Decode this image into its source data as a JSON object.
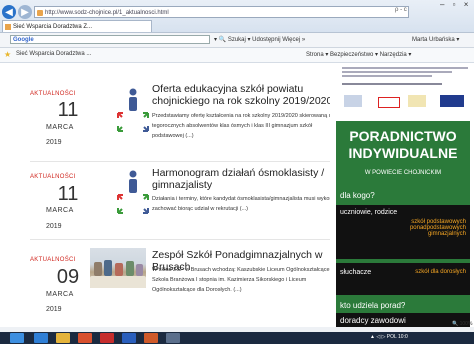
{
  "browser": {
    "url": "http://www.sodz-chojnice.pl/1_aktualnosci.html",
    "tab_label": "Sieć Wsparcia Doradztwa Z...",
    "search_glyph": "ρ - c",
    "window_controls": "– ▫ ×"
  },
  "google_bar": {
    "brand": "Google",
    "tools": "▾ 🔍 Szukaj ▾  Udostępnij  Więcej »",
    "user": "Marta Urbańska ▾"
  },
  "favorites": {
    "site": "Sieć Wsparcia Doradztwa ...",
    "commands": "Strona ▾  Bezpieczeństwo ▾  Narzędzia ▾"
  },
  "articles": [
    {
      "category": "AKTUALNOŚCI",
      "day": "11",
      "month": "MARCA",
      "year": "2019",
      "title": "Oferta edukacyjna szkół powiatu chojnickiego na rok szkolny 2019/2020",
      "excerpt": "Przedstawiamy ofertę kształcenia na rok szkolny 2019/2020 skierowaną do tegorocznych absolwentów klas ósmych i klas III gimnazjum szkół podstawowej (...)"
    },
    {
      "category": "AKTUALNOŚCI",
      "day": "11",
      "month": "MARCA",
      "year": "2019",
      "title": "Harmonogram działań ósmoklasisty / gimnazjalisty",
      "excerpt": "Działania i terminy, które kandydat ósmoklasista/gimnazjalista musi wykonać i zachować biorąc udział w rekrutacji (...)"
    },
    {
      "category": "AKTUALNOŚCI",
      "day": "09",
      "month": "MARCA",
      "year": "2019",
      "title": "Zespół Szkół Ponadgimnazjalnych w Brusach",
      "excerpt": "W skład ZSP w Brusach wchodzą: Kaszubskie Liceum Ogólnokształcące, Szkoła Branżowa I stopnia im. Kazimierza Sikorskiego i Liceum Ogólnokształcące dla Dorosłych. (...)"
    }
  ],
  "sidebar": {
    "headline": "PORADNICTWO INDYWIDUALNE",
    "subline": "W POWIECIE CHOJNICKIM",
    "question1": "dla kogo?",
    "who1": "uczniowie, rodzice",
    "who1_detail": "szkół podstawowych ponadpodstawowych gimnazjalnych",
    "who2": "słuchacze",
    "who2_detail": "szkół dla dorosłych",
    "question2": "kto udziela porad?",
    "answer2": "doradcy zawodowi"
  },
  "status": {
    "zoom": "🔍 100%",
    "tray": "▲ ◁ ▷ POL",
    "time": "10:0"
  },
  "colors": {
    "accent_red": "#d0261e",
    "sidebar_green": "#2b7a3a",
    "sidebar_orange": "#f6a623",
    "taskbar": "#1b2a40"
  }
}
